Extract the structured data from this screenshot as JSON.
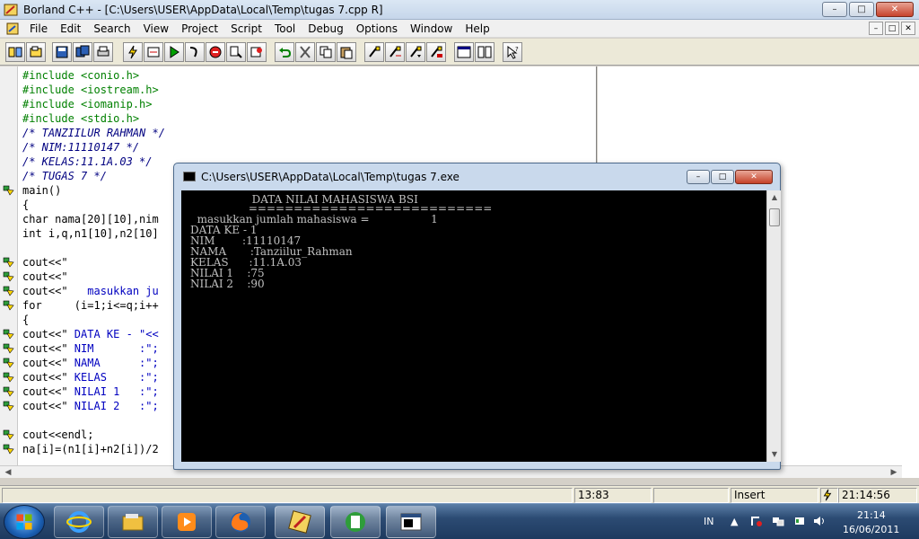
{
  "window": {
    "title": "Borland C++ - [C:\\Users\\USER\\AppData\\Local\\Temp\\tugas 7.cpp R]",
    "minimize": "–",
    "maximize": "□",
    "close": "✕"
  },
  "menu": [
    "File",
    "Edit",
    "Search",
    "View",
    "Project",
    "Script",
    "Tool",
    "Debug",
    "Options",
    "Window",
    "Help"
  ],
  "mdi_controls": [
    "–",
    "□",
    "✕"
  ],
  "editor": {
    "lines": [
      {
        "text": "#include <conio.h>",
        "style": "pre",
        "bp": false
      },
      {
        "text": "#include <iostream.h>",
        "style": "pre",
        "bp": false
      },
      {
        "text": "#include <iomanip.h>",
        "style": "pre",
        "bp": false
      },
      {
        "text": "#include <stdio.h>",
        "style": "pre",
        "bp": false
      },
      {
        "text": "/* TANZIILUR RAHMAN */",
        "style": "com",
        "bp": false
      },
      {
        "text": "/* NIM:11110147 */",
        "style": "com",
        "bp": false
      },
      {
        "text": "/* KELAS:11.1A.03 */",
        "style": "com",
        "bp": false
      },
      {
        "text": "/* TUGAS 7 */",
        "style": "com",
        "bp": false
      },
      {
        "text": "main()",
        "style": "norm",
        "bp": true
      },
      {
        "text": "{",
        "style": "norm",
        "bp": false
      },
      {
        "text": "char nama[20][10],nim",
        "style": "norm",
        "bp": false
      },
      {
        "text": "int i,q,n1[10],n2[10]",
        "style": "norm",
        "bp": false
      },
      {
        "text": "",
        "style": "norm",
        "bp": false
      },
      {
        "text": "cout<<\"",
        "style": "norm",
        "bp": true
      },
      {
        "text": "cout<<\"",
        "style": "norm",
        "bp": true
      },
      {
        "text": "cout<<\"   masukkan ju",
        "style": "mix",
        "pre": "cout<<\"",
        "str": "   masukkan ju",
        "bp": true
      },
      {
        "text": "for     (i=1;i<=q;i++",
        "style": "norm",
        "bp": true
      },
      {
        "text": "{",
        "style": "norm",
        "bp": false
      },
      {
        "text": "cout<<\" DATA KE - \"<<",
        "style": "mix",
        "pre": "cout<<\"",
        "str": " DATA KE - \"<<",
        "bp": true
      },
      {
        "text": "cout<<\" NIM       :\";",
        "style": "mix",
        "pre": "cout<<\"",
        "str": " NIM       :\";",
        "bp": true
      },
      {
        "text": "cout<<\" NAMA      :\";",
        "style": "mix",
        "pre": "cout<<\"",
        "str": " NAMA      :\";",
        "bp": true
      },
      {
        "text": "cout<<\" KELAS     :\";",
        "style": "mix",
        "pre": "cout<<\"",
        "str": " KELAS     :\";",
        "bp": true
      },
      {
        "text": "cout<<\" NILAI 1   :\";",
        "style": "mix",
        "pre": "cout<<\"",
        "str": " NILAI 1   :\";",
        "bp": true
      },
      {
        "text": "cout<<\" NILAI 2   :\";",
        "style": "mix",
        "pre": "cout<<\"",
        "str": " NILAI 2   :\";",
        "bp": true
      },
      {
        "text": "",
        "style": "norm",
        "bp": false
      },
      {
        "text": "cout<<endl;",
        "style": "norm",
        "bp": true
      },
      {
        "text": "na[i]=(n1[i]+n2[i])/2",
        "style": "norm",
        "bp": true
      }
    ]
  },
  "console": {
    "title": "C:\\Users\\USER\\AppData\\Local\\Temp\\tugas 7.exe",
    "lines": [
      "                  DATA NILAI MAHASISWA BSI",
      "                 ===========================",
      "  masukkan jumlah mahasiswa =                  1",
      "DATA KE - 1",
      "NIM        :11110147",
      "NAMA       :Tanziilur_Rahman",
      "KELAS      :11.1A.03",
      "NILAI 1    :75",
      "NILAI 2    :90"
    ]
  },
  "status": {
    "position": "13:83",
    "mode": "Insert",
    "time": "21:14:56"
  },
  "taskbar": {
    "lang": "IN",
    "clock_time": "21:14",
    "clock_date": "16/06/2011"
  }
}
